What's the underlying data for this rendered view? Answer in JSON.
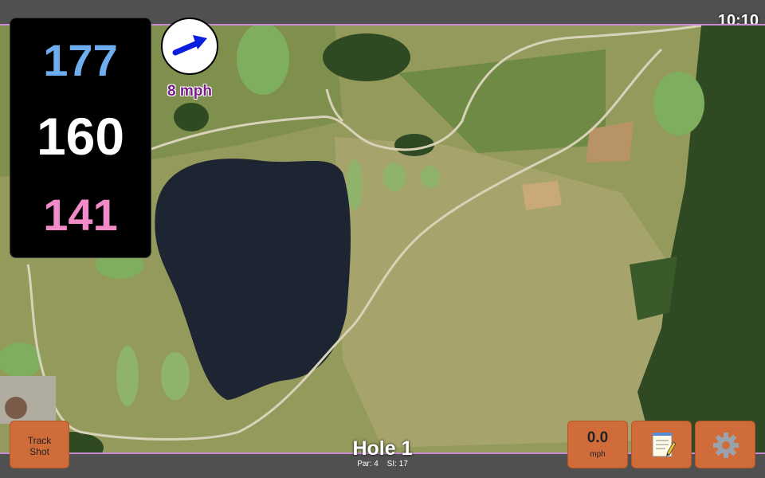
{
  "clock": "10:10",
  "distances": {
    "back": "177",
    "middle": "160",
    "front": "141",
    "back_color": "#6eaef0",
    "middle_color": "#ffffff",
    "front_color": "#f08ac8"
  },
  "wind": {
    "speed_label": "8 mph",
    "icon": "wind-direction-arrow-icon",
    "arrow_color": "#0a1ee0"
  },
  "buttons": {
    "track_shot": "Track\nShot",
    "track_shot_line1": "Track",
    "track_shot_line2": "Shot",
    "speed_value": "0.0",
    "speed_unit": "mph",
    "notes_icon": "notepad-icon",
    "settings_icon": "gear-icon",
    "button_color": "#d06c3a"
  },
  "hole": {
    "title": "Hole 1",
    "par": "Par: 4",
    "si": "SI: 17"
  }
}
